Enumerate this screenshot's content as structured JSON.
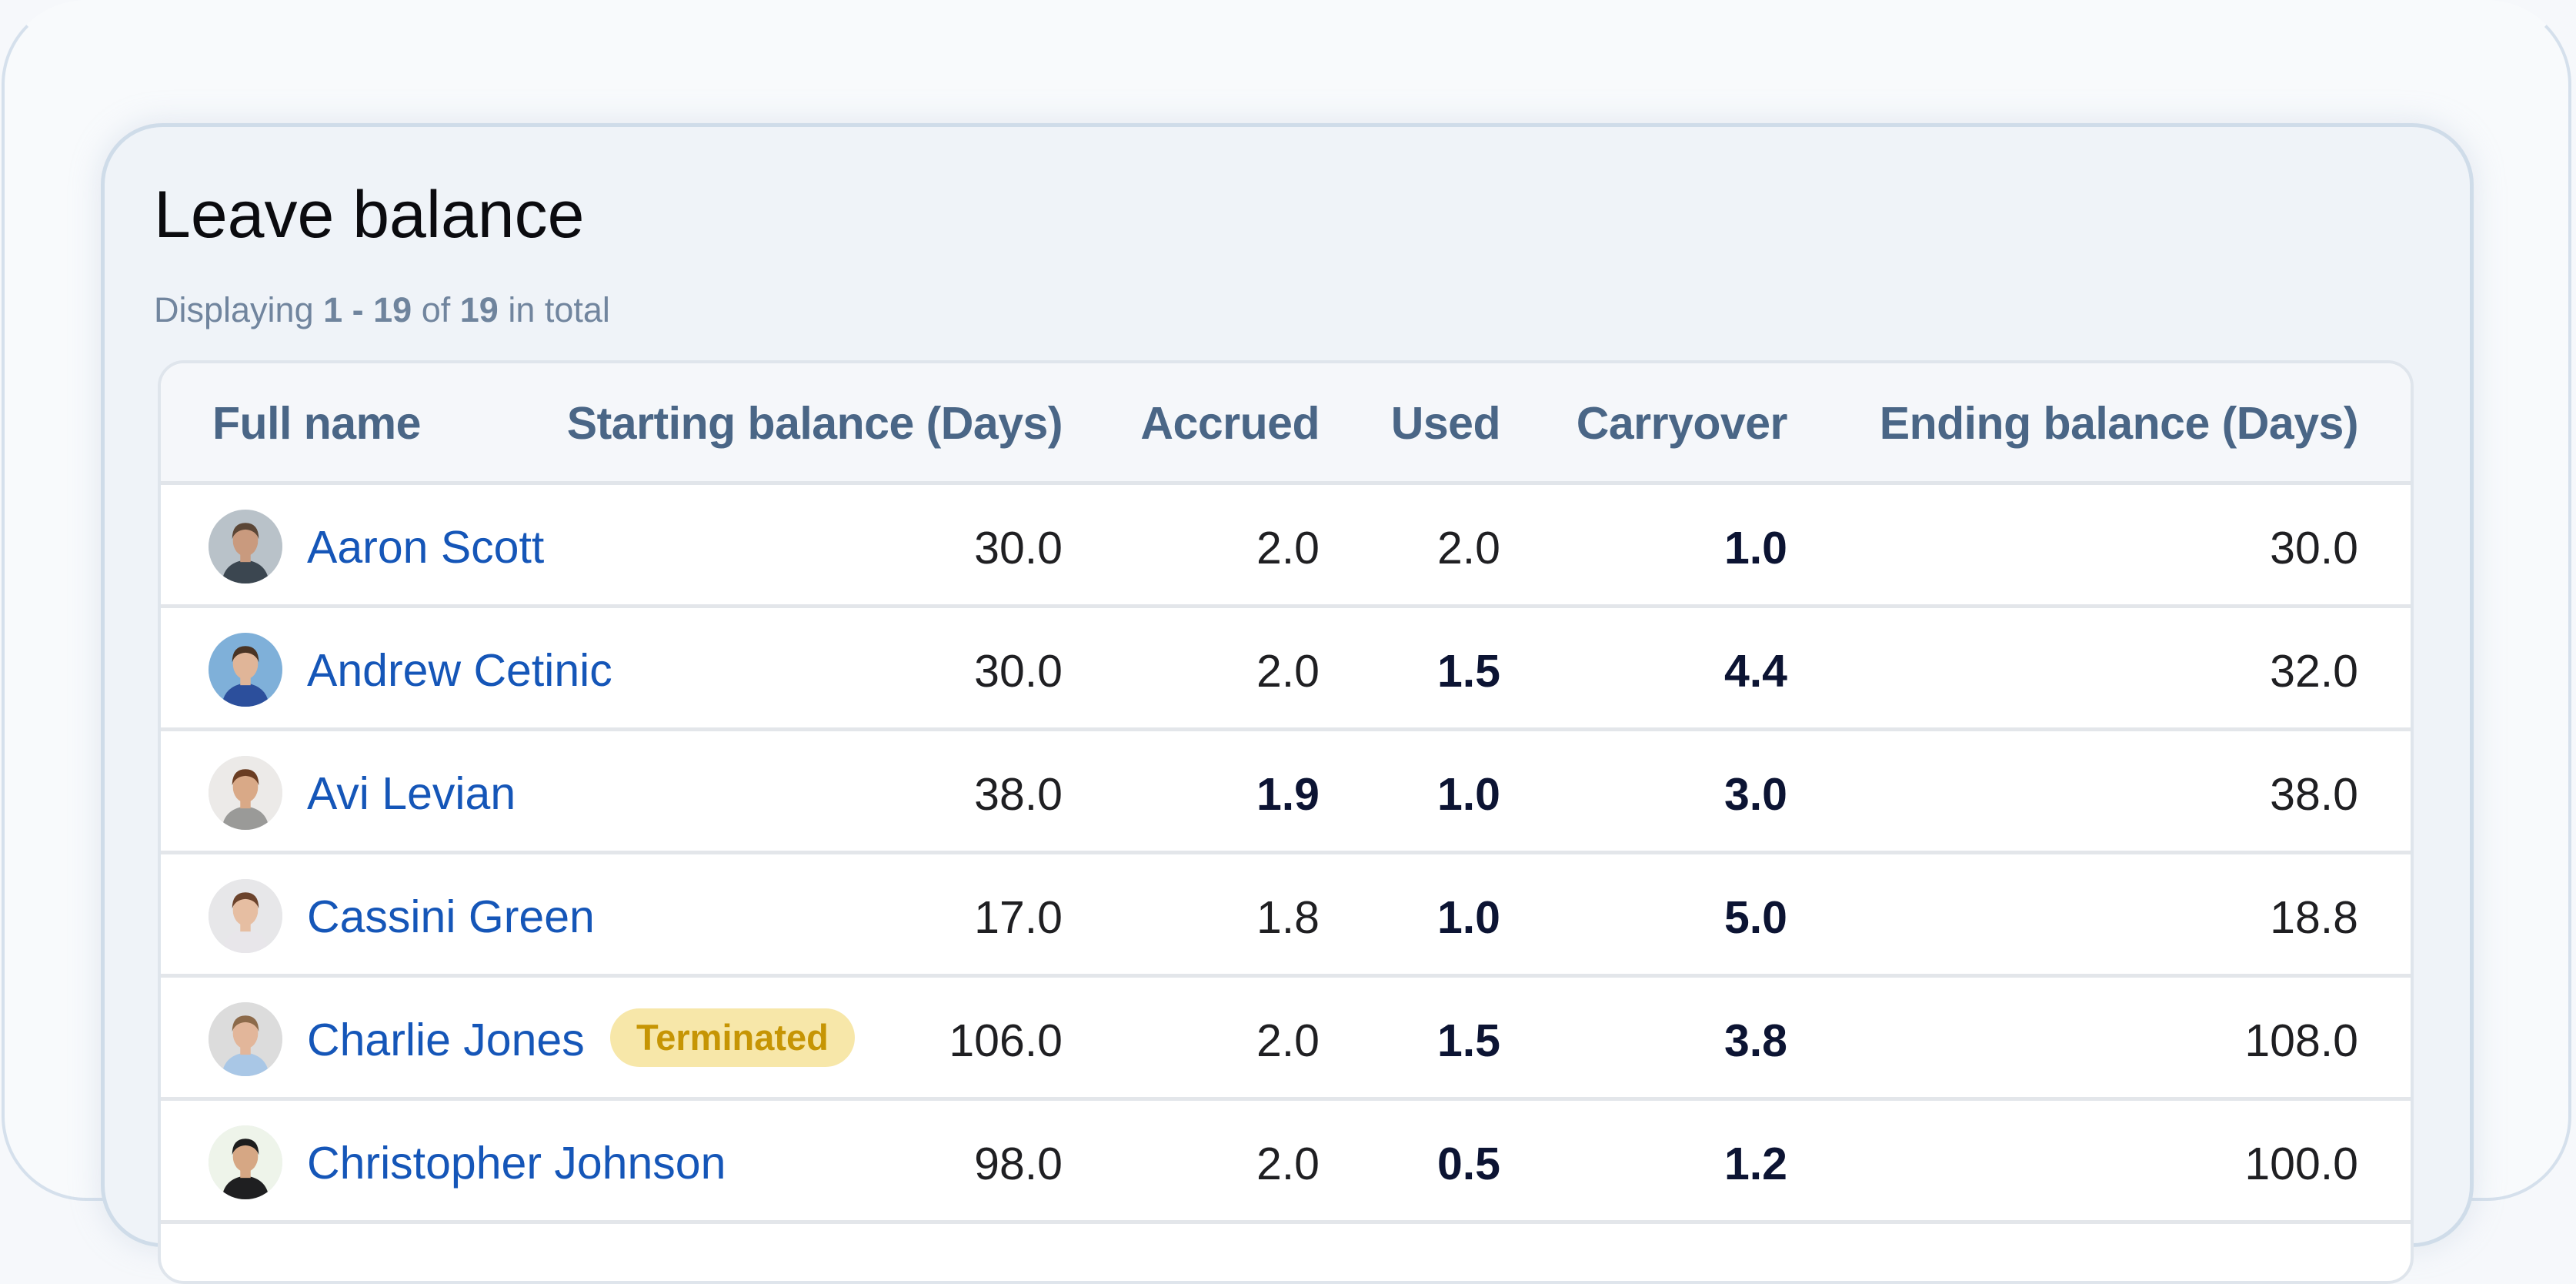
{
  "page": {
    "title": "Leave balance",
    "summary": {
      "prefix": "Displaying",
      "range": "1 - 19",
      "of_label": "of",
      "total": "19",
      "suffix": "in total"
    }
  },
  "table": {
    "columns": [
      {
        "key": "full_name",
        "label": "Full name"
      },
      {
        "key": "starting_balance",
        "label": "Starting balance (Days)"
      },
      {
        "key": "accrued",
        "label": "Accrued"
      },
      {
        "key": "used",
        "label": "Used"
      },
      {
        "key": "carryover",
        "label": "Carryover"
      },
      {
        "key": "ending_balance",
        "label": "Ending balance (Days)"
      }
    ],
    "rows": [
      {
        "name": "Aaron Scott",
        "badge": null,
        "starting_balance": "30.0",
        "accrued": "2.0",
        "used": "2.0",
        "carryover": "1.0",
        "ending_balance": "30.0",
        "bold": {
          "accrued": false,
          "used": false,
          "carryover": true
        }
      },
      {
        "name": "Andrew Cetinic",
        "badge": null,
        "starting_balance": "30.0",
        "accrued": "2.0",
        "used": "1.5",
        "carryover": "4.4",
        "ending_balance": "32.0",
        "bold": {
          "accrued": false,
          "used": true,
          "carryover": true
        }
      },
      {
        "name": "Avi Levian",
        "badge": null,
        "starting_balance": "38.0",
        "accrued": "1.9",
        "used": "1.0",
        "carryover": "3.0",
        "ending_balance": "38.0",
        "bold": {
          "accrued": true,
          "used": true,
          "carryover": true
        }
      },
      {
        "name": "Cassini Green",
        "badge": null,
        "starting_balance": "17.0",
        "accrued": "1.8",
        "used": "1.0",
        "carryover": "5.0",
        "ending_balance": "18.8",
        "bold": {
          "accrued": false,
          "used": true,
          "carryover": true
        }
      },
      {
        "name": "Charlie Jones",
        "badge": "Terminated",
        "starting_balance": "106.0",
        "accrued": "2.0",
        "used": "1.5",
        "carryover": "3.8",
        "ending_balance": "108.0",
        "bold": {
          "accrued": false,
          "used": true,
          "carryover": true
        }
      },
      {
        "name": "Christopher Johnson",
        "badge": null,
        "starting_balance": "98.0",
        "accrued": "2.0",
        "used": "0.5",
        "carryover": "1.2",
        "ending_balance": "100.0",
        "bold": {
          "accrued": false,
          "used": true,
          "carryover": true
        }
      }
    ]
  },
  "colors": {
    "link": "#1556b8",
    "header_text": "#4a6686",
    "badge_bg": "#f7e7a9",
    "badge_text": "#c69504"
  },
  "avatars": [
    {
      "bg": "#b9c2c9",
      "skin": "#c99a7e",
      "hair": "#5b4636",
      "shirt": "#3b4650"
    },
    {
      "bg": "#7fb0d9",
      "skin": "#e0b598",
      "hair": "#4a3424",
      "shirt": "#2c4f9c"
    },
    {
      "bg": "#eceae8",
      "skin": "#d9a987",
      "hair": "#6a3d22",
      "shirt": "#9a9a98"
    },
    {
      "bg": "#e7e7e9",
      "skin": "#e6bea2",
      "hair": "#6b432c",
      "shirt": "#e8e6ea"
    },
    {
      "bg": "#dcdcdc",
      "skin": "#e2b69a",
      "hair": "#8c6a4a",
      "shirt": "#a9c7e6"
    },
    {
      "bg": "#eef4ea",
      "skin": "#d6a784",
      "hair": "#1d1d1d",
      "shirt": "#1f1f21"
    }
  ]
}
